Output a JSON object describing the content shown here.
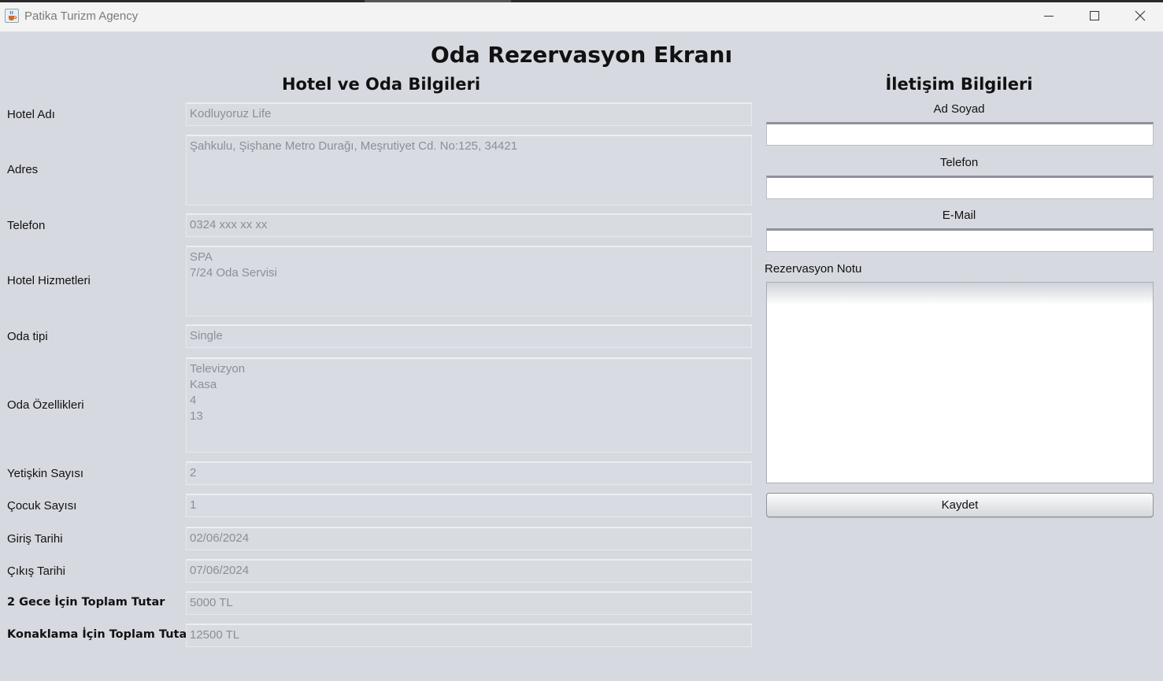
{
  "window": {
    "title": "Patika Turizm Agency"
  },
  "page": {
    "title": "Oda Rezervasyon Ekranı"
  },
  "hotel_section": {
    "heading": "Hotel ve Oda Bilgileri",
    "fields": [
      {
        "label": "Hotel Adı",
        "value": "Kodluyoruz Life"
      },
      {
        "label": "Adres",
        "value": "Şahkulu, Şişhane Metro Durağı, Meşrutiyet Cd. No:125, 34421"
      },
      {
        "label": "Telefon",
        "value": "0324 xxx xx xx"
      },
      {
        "label": "Hotel Hizmetleri",
        "value": "SPA\n7/24 Oda Servisi"
      },
      {
        "label": "Oda tipi",
        "value": "Single"
      },
      {
        "label": "Oda Özellikleri",
        "value": "Televizyon\nKasa\n4\n13"
      },
      {
        "label": "Yetişkin Sayısı",
        "value": "2"
      },
      {
        "label": "Çocuk Sayısı",
        "value": "1"
      },
      {
        "label": "Giriş Tarihi",
        "value": "02/06/2024"
      },
      {
        "label": "Çıkış Tarihi",
        "value": "07/06/2024"
      },
      {
        "label": "2 Gece İçin Toplam Tutar",
        "value": "5000 TL"
      },
      {
        "label": "Konaklama İçin Toplam Tutar",
        "value": "12500 TL"
      }
    ]
  },
  "contact_section": {
    "heading": "İletişim Bilgileri",
    "name_label": "Ad Soyad",
    "name_value": "",
    "phone_label": "Telefon",
    "phone_value": "",
    "email_label": "E-Mail",
    "email_value": "",
    "note_label": "Rezervasyon Notu",
    "note_value": "",
    "save_label": "Kaydet"
  },
  "icons": {
    "app": "java-cup-icon",
    "minimize": "minimize-icon",
    "maximize": "maximize-icon",
    "close": "close-icon"
  }
}
